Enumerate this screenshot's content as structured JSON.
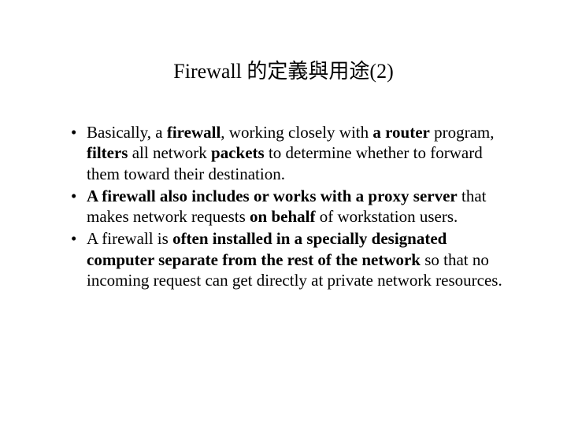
{
  "slide": {
    "title": "Firewall 的定義與用途(2)",
    "bullets": [
      {
        "segments": [
          {
            "text": "Basically, a ",
            "bold": false
          },
          {
            "text": "firewall",
            "bold": true
          },
          {
            "text": ", working closely with ",
            "bold": false
          },
          {
            "text": "a router",
            "bold": true
          },
          {
            "text": " program, ",
            "bold": false
          },
          {
            "text": "filters",
            "bold": true
          },
          {
            "text": " all network ",
            "bold": false
          },
          {
            "text": "packets",
            "bold": true
          },
          {
            "text": " to determine whether to forward them toward their destination.",
            "bold": false
          }
        ]
      },
      {
        "segments": [
          {
            "text": "A firewall also includes or works with a proxy server",
            "bold": true
          },
          {
            "text": " that makes network requests ",
            "bold": false
          },
          {
            "text": "on behalf",
            "bold": true
          },
          {
            "text": " of workstation users.",
            "bold": false
          }
        ]
      },
      {
        "segments": [
          {
            "text": "A firewall is ",
            "bold": false
          },
          {
            "text": "often installed in a specially designated computer separate from the rest of the network",
            "bold": true
          },
          {
            "text": " so that no incoming request can get directly at private network resources.",
            "bold": false
          }
        ]
      }
    ]
  }
}
